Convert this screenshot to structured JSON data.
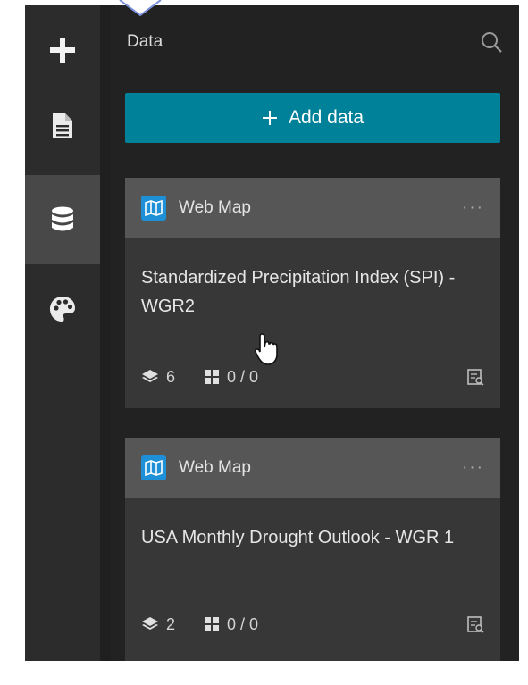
{
  "panel": {
    "title": "Data",
    "add_data_label": "Add data"
  },
  "rail": {
    "items": [
      "add",
      "page",
      "data",
      "theme"
    ],
    "active": "data"
  },
  "cards": [
    {
      "type": "Web Map",
      "title": "Standardized Precipitation Index (SPI) - WGR2",
      "layers": "6",
      "tables": "0 / 0"
    },
    {
      "type": "Web Map",
      "title": "USA Monthly Drought Outlook - WGR 1",
      "layers": "2",
      "tables": "0 / 0"
    }
  ],
  "colors": {
    "accent": "#00819a",
    "map_badge": "#1e90d8",
    "frame_bg": "#1f1f1f"
  }
}
